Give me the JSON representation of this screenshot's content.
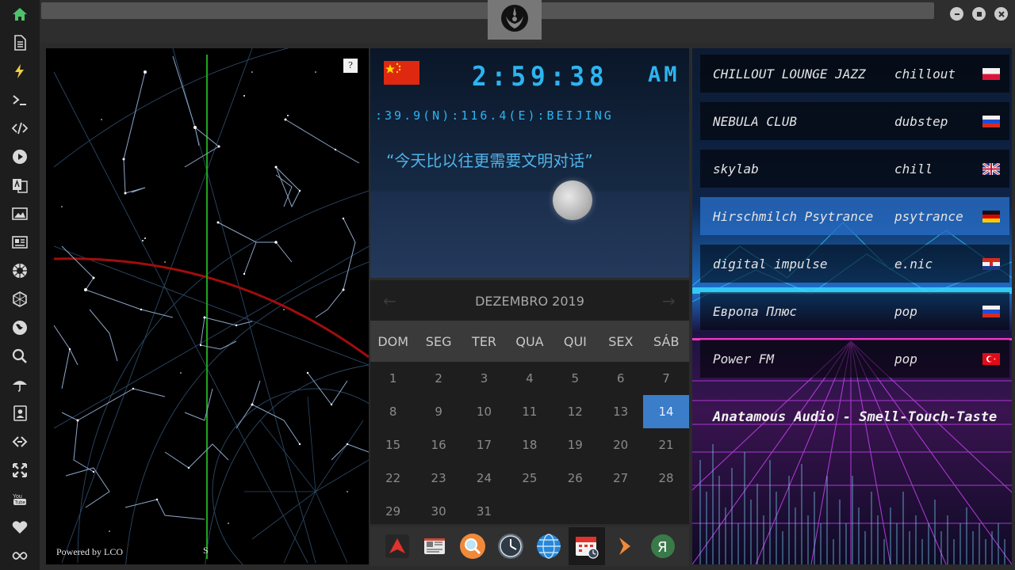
{
  "sidebar": {
    "icons": [
      "home-icon",
      "document-icon",
      "lightning-icon",
      "terminal-icon",
      "code-icon",
      "play-icon",
      "translate-icon",
      "image-icon",
      "news-icon",
      "rebel-icon",
      "hexagon-icon",
      "globe-icon",
      "search-icon",
      "umbrella-icon",
      "contact-icon",
      "link-icon",
      "expand-icon",
      "youtube-icon",
      "heart-icon",
      "infinity-icon"
    ]
  },
  "window": {
    "logo": "rebel-alliance-logo",
    "controls": [
      "minimize-icon",
      "maximize-icon",
      "close-icon"
    ]
  },
  "starmap": {
    "help_label": "?",
    "powered_by": "Powered by LCO",
    "direction": "S"
  },
  "clock": {
    "country_flag": "china-flag",
    "time": "2:59:38",
    "ampm": "AM",
    "coords": ":39.9(N):116.4(E):BEIJING",
    "quote": "“今天比以往更需要文明对话”"
  },
  "calendar": {
    "month_label": "DEZEMBRO 2019",
    "prev_arrow": "←",
    "next_arrow": "→",
    "weekdays": [
      "DOM",
      "SEG",
      "TER",
      "QUA",
      "QUI",
      "SEX",
      "SÁB"
    ],
    "weeks": [
      [
        "1",
        "2",
        "3",
        "4",
        "5",
        "6",
        "7"
      ],
      [
        "8",
        "9",
        "10",
        "11",
        "12",
        "13",
        "14"
      ],
      [
        "15",
        "16",
        "17",
        "18",
        "19",
        "20",
        "21"
      ],
      [
        "22",
        "23",
        "24",
        "25",
        "26",
        "27",
        "28"
      ],
      [
        "29",
        "30",
        "31",
        "",
        "",
        "",
        ""
      ]
    ],
    "today": "14"
  },
  "dock": {
    "apps": [
      "arch-app-icon",
      "news-app-icon",
      "search-app-icon",
      "clock-app-icon",
      "globe-app-icon",
      "calendar-app-icon",
      "play-app-icon",
      "yandex-app-icon"
    ],
    "active": "calendar-app-icon"
  },
  "radio": {
    "stations": [
      {
        "name": "CHILLOUT LOUNGE JAZZ",
        "genre": "chillout",
        "flag": "poland-flag"
      },
      {
        "name": "NEBULA CLUB",
        "genre": "dubstep",
        "flag": "russia-flag"
      },
      {
        "name": "skylab",
        "genre": "chill",
        "flag": "uk-flag"
      },
      {
        "name": "Hirschmilch Psytrance",
        "genre": "psytrance",
        "flag": "germany-flag"
      },
      {
        "name": "digital impulse",
        "genre": "e.nic",
        "flag": "croatia-flag"
      },
      {
        "name": "Европа Плюс",
        "genre": "pop",
        "flag": "russia-flag"
      },
      {
        "name": "Power FM",
        "genre": "pop",
        "flag": "turkey-flag"
      }
    ],
    "selected_index": 3,
    "now_playing": "Anatamous Audio - Smell-Touch-Taste"
  },
  "colors": {
    "accent_blue": "#2cb5f0",
    "today_blue": "#3b7dc9",
    "selected_station": "#2a6ec8"
  }
}
